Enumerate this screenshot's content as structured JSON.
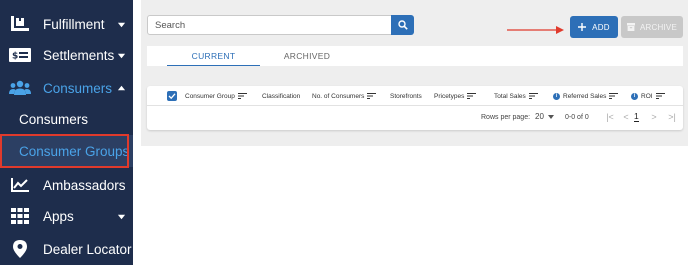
{
  "sidebar": {
    "items": [
      {
        "label": "Fulfillment",
        "icon": "warehouse-icon",
        "expandable": true
      },
      {
        "label": "Settlements",
        "icon": "money-icon",
        "expandable": true
      },
      {
        "label": "Consumers",
        "icon": "users-icon",
        "expandable": true,
        "expanded": true
      },
      {
        "label": "Ambassadors",
        "icon": "chart-line-icon",
        "expandable": false
      },
      {
        "label": "Apps",
        "icon": "grid-icon",
        "expandable": true
      },
      {
        "label": "Dealer Locator",
        "icon": "map-pin-icon",
        "expandable": false
      }
    ],
    "subitems": [
      {
        "label": "Consumers"
      },
      {
        "label": "Consumer Groups",
        "selected": true
      }
    ]
  },
  "search": {
    "placeholder": "Search"
  },
  "toolbar": {
    "add_label": "ADD",
    "archive_label": "ARCHIVE"
  },
  "tabs": [
    {
      "label": "CURRENT",
      "active": true
    },
    {
      "label": "ARCHIVED",
      "active": false
    }
  ],
  "table": {
    "columns": [
      {
        "label": "Consumer Group",
        "sortable": true,
        "info": false
      },
      {
        "label": "Classification",
        "sortable": false,
        "info": false
      },
      {
        "label": "No. of Consumers",
        "sortable": true,
        "info": false
      },
      {
        "label": "Storefronts",
        "sortable": false,
        "info": false
      },
      {
        "label": "Pricetypes",
        "sortable": true,
        "info": false
      },
      {
        "label": "Total Sales",
        "sortable": true,
        "info": false
      },
      {
        "label": "Referred Sales",
        "sortable": true,
        "info": true
      },
      {
        "label": "ROI",
        "sortable": true,
        "info": true
      }
    ],
    "rows": []
  },
  "pagination": {
    "rows_per_page_label": "Rows per page:",
    "rows_per_page": "20",
    "range": "0-0 of 0",
    "page": "1"
  },
  "colors": {
    "sidebar_bg": "#1e2d4c",
    "accent": "#2d6fb7",
    "active_text": "#4aa3e8",
    "highlight": "#e03a2c"
  }
}
